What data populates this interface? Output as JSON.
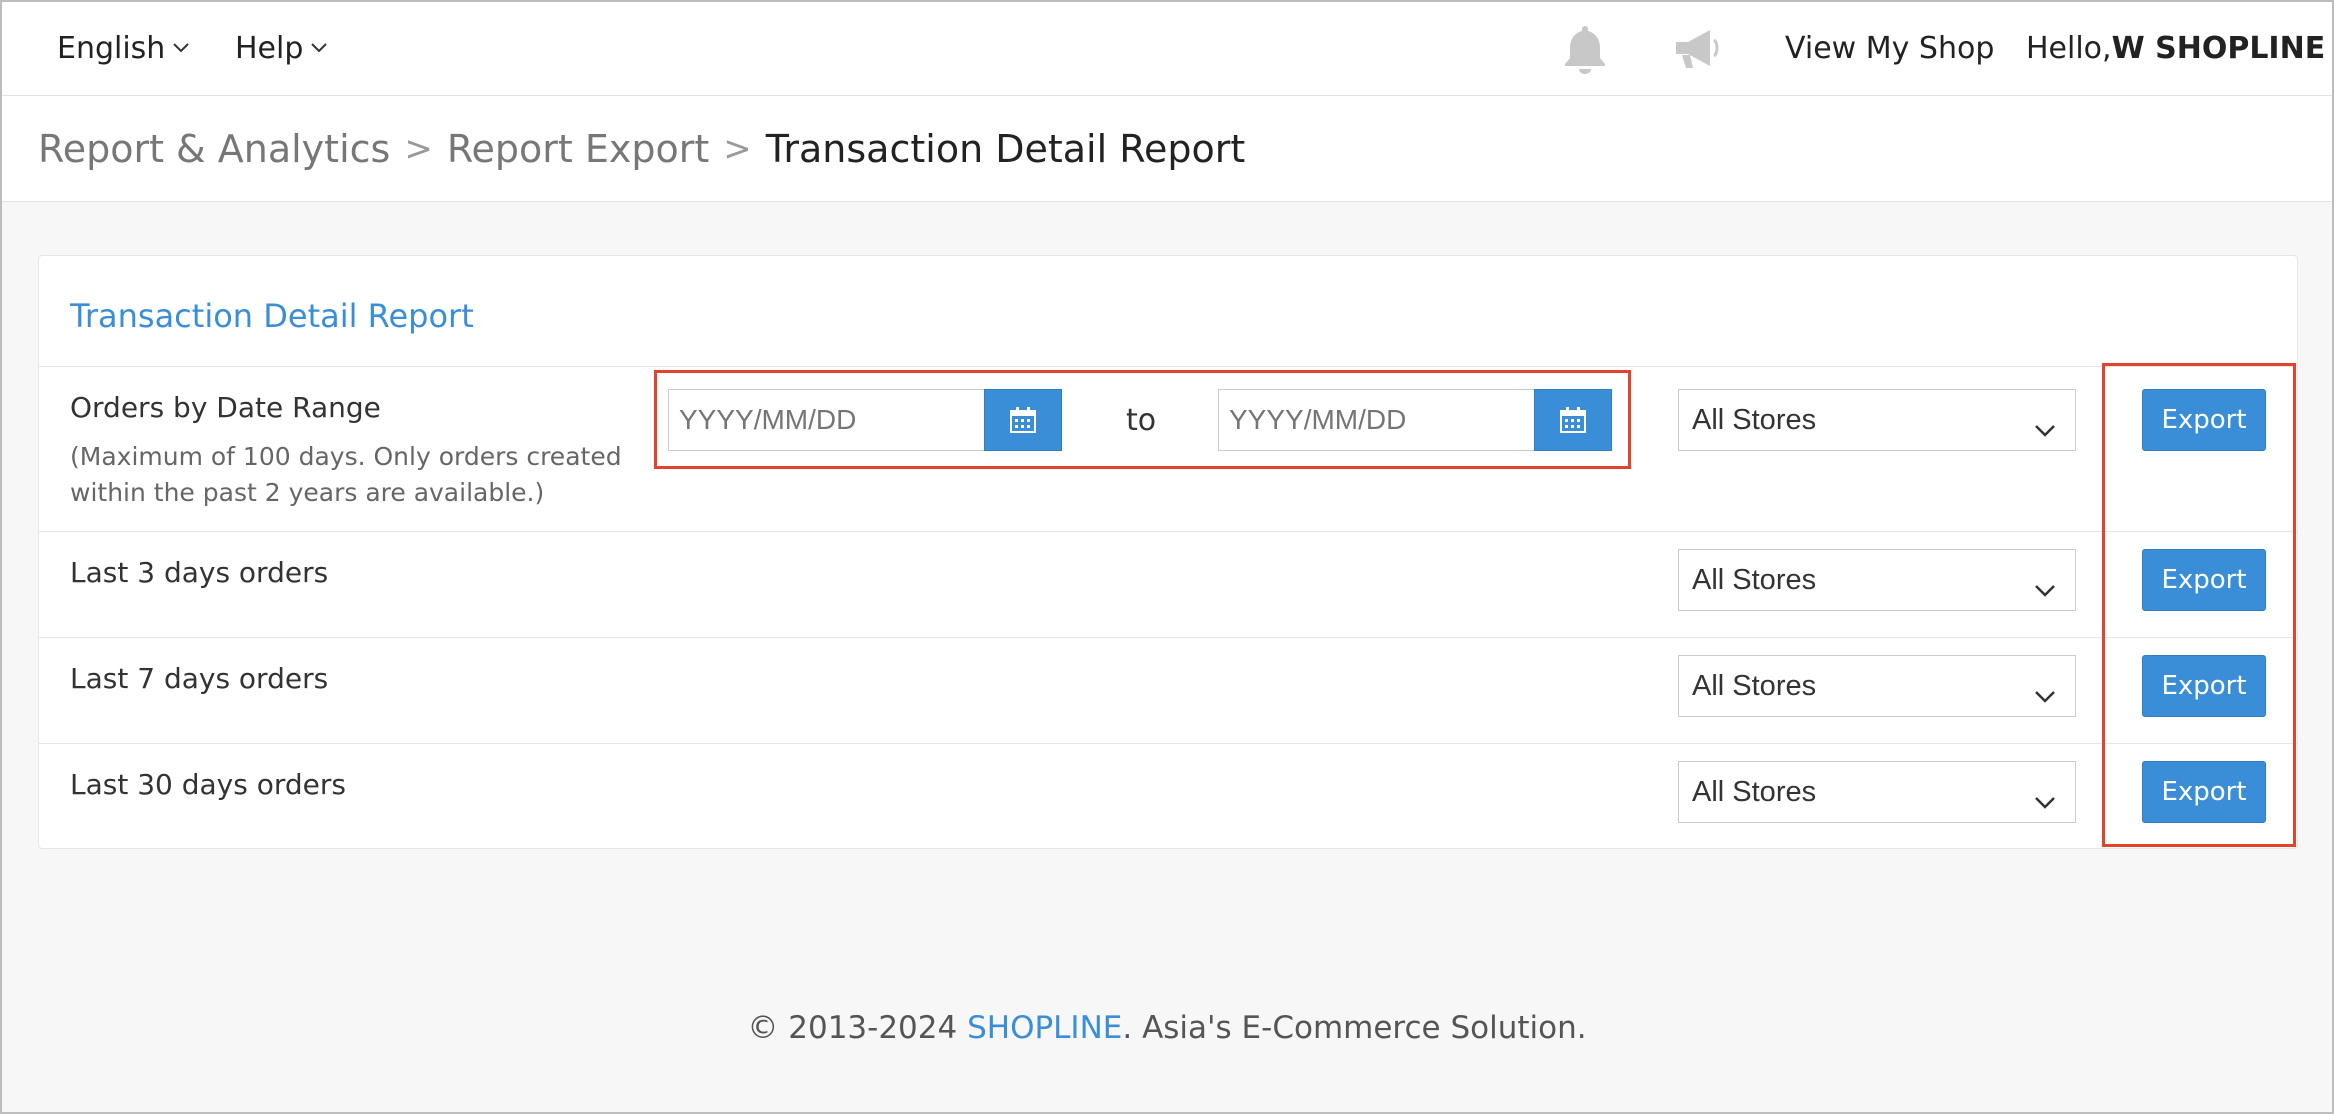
{
  "topbar": {
    "language": "English",
    "help": "Help",
    "view_shop": "View My Shop",
    "hello_prefix": "Hello, ",
    "shop_name": "W SHOPLINE",
    "icons": [
      "bell-icon",
      "megaphone-icon"
    ]
  },
  "breadcrumb": {
    "items": [
      "Report & Analytics",
      "Report Export"
    ],
    "current": "Transaction Detail Report",
    "separator": ">"
  },
  "panel": {
    "title": "Transaction Detail Report",
    "rows": [
      {
        "label": "Orders by Date Range",
        "hint": "(Maximum of 100 days. Only orders created within the past 2 years are available.)",
        "date_from_placeholder": "YYYY/MM/DD",
        "to_label": "to",
        "date_to_placeholder": "YYYY/MM/DD",
        "store": "All Stores",
        "export": "Export"
      },
      {
        "label": "Last 3 days orders",
        "store": "All Stores",
        "export": "Export"
      },
      {
        "label": "Last 7 days orders",
        "store": "All Stores",
        "export": "Export"
      },
      {
        "label": "Last 30 days orders",
        "store": "All Stores",
        "export": "Export"
      }
    ]
  },
  "footer": {
    "copyright": "© 2013-2024 ",
    "brand": "SHOPLINE",
    "tagline": ". Asia's E-Commerce Solution."
  },
  "colors": {
    "accent": "#3a8ed8",
    "highlight": "#e0442d"
  }
}
